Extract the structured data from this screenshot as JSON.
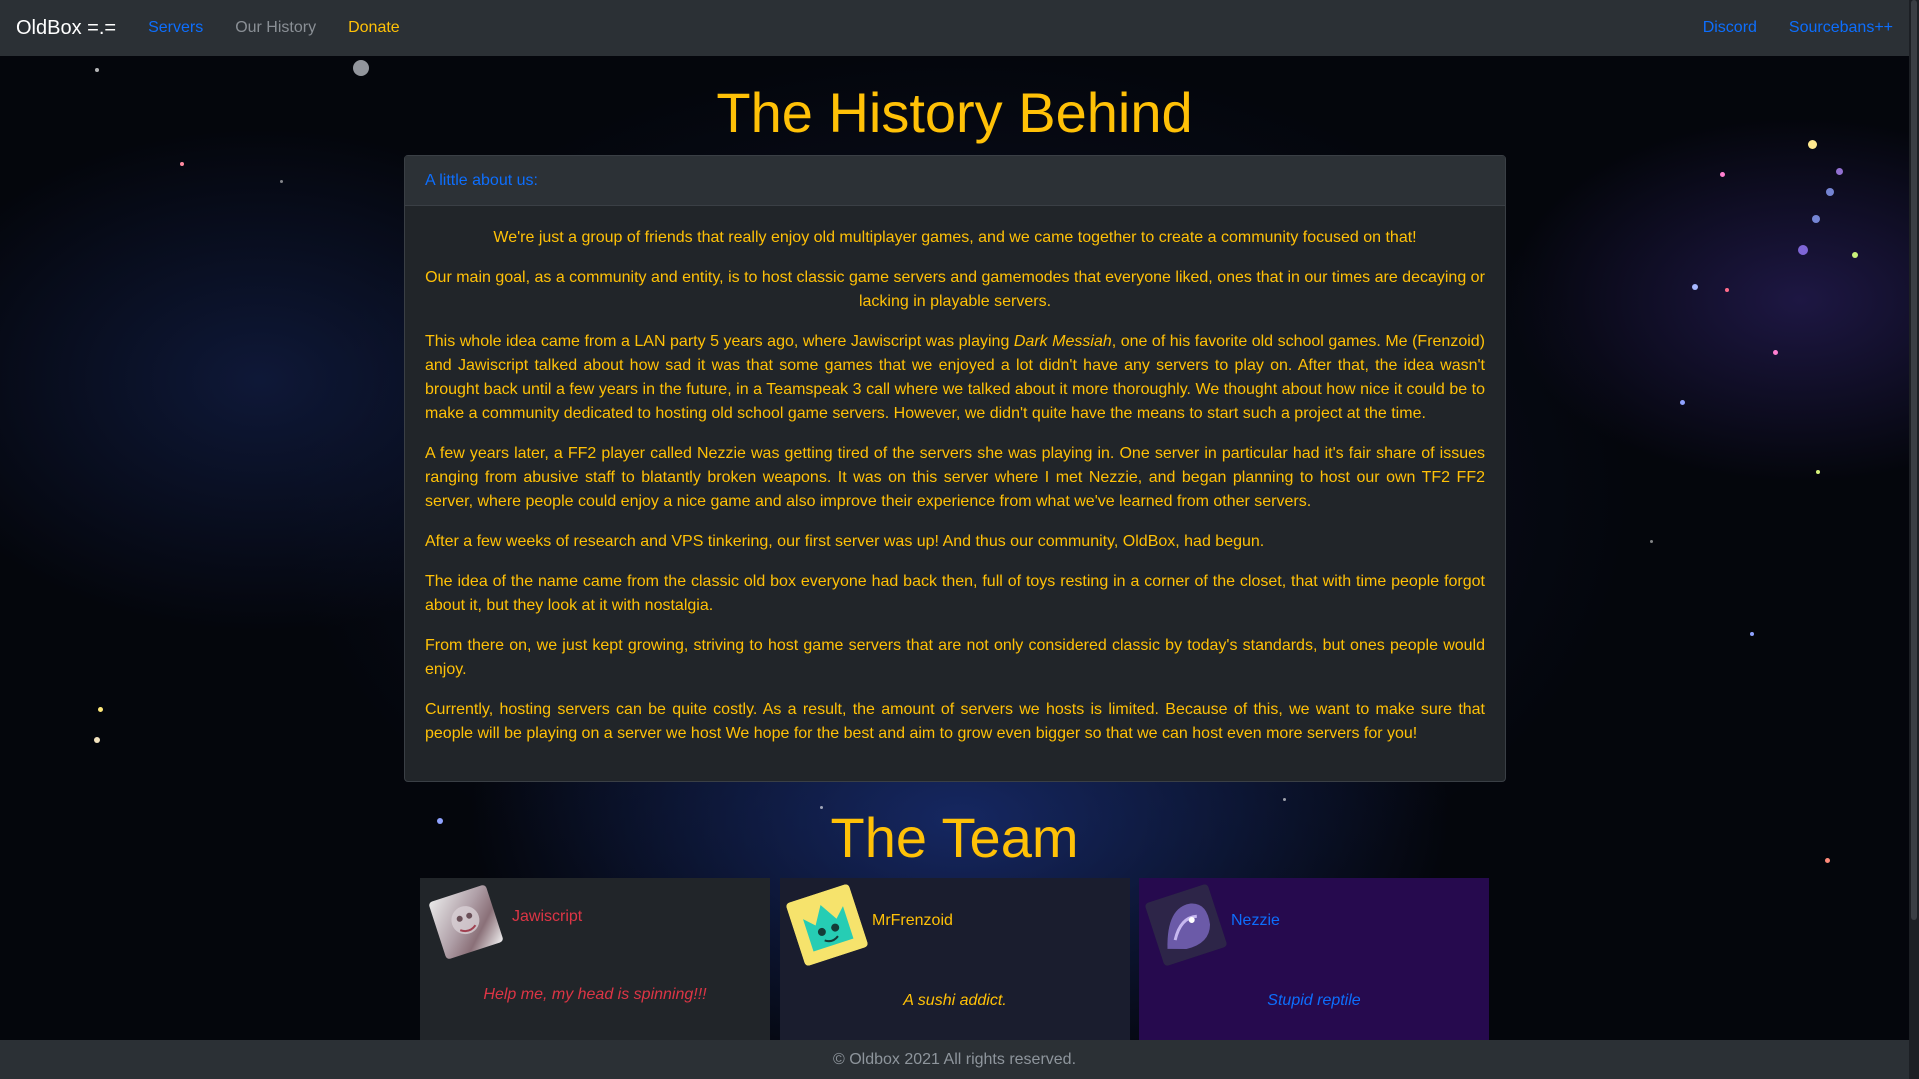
{
  "navbar": {
    "brand": "OldBox =.=",
    "links": [
      {
        "label": "Servers",
        "color": "#0d6efd"
      },
      {
        "label": "Our History",
        "color": "#8a8f95"
      },
      {
        "label": "Donate",
        "color": "#ffc107"
      }
    ],
    "right_links": [
      {
        "label": "Discord",
        "color": "#0d6efd"
      },
      {
        "label": "Sourcebans++",
        "color": "#0d6efd"
      }
    ]
  },
  "history": {
    "title": "The History Behind",
    "card_header": "A little about us:",
    "p1": "We're just a group of friends that really enjoy old multiplayer games, and we came together to create a community focused on that!",
    "p2": "Our main goal, as a community and entity, is to host classic game servers and gamemodes that everyone liked, ones that in our times are decaying or lacking in playable servers.",
    "p3_before": "This whole idea came from a LAN party 5 years ago, where Jawiscript was playing ",
    "p3_em": "Dark Messiah",
    "p3_after": ", one of his favorite old school games. Me (Frenzoid) and Jawiscript talked about how sad it was that some games that we enjoyed a lot didn't have any servers to play on. After that, the idea wasn't brought back until a few years in the future, in a Teamspeak 3 call where we talked about it more thoroughly. We thought about how nice it could be to make a community dedicated to hosting old school game servers. However, we didn't quite have the means to start such a project at the time.",
    "p4": "A few years later, a FF2 player called Nezzie was getting tired of the servers she was playing in. One server in particular had it's fair share of issues ranging from abusive staff to blatantly broken weapons. It was on this server where I met Nezzie, and began planning to host our own TF2 FF2 server, where people could enjoy a nice game and also improve their experience from what we've learned from other servers.",
    "p5": "After a few weeks of research and VPS tinkering, our first server was up! And thus our community, OldBox, had begun.",
    "p6": "The idea of the name came from the classic old box everyone had back then, full of toys resting in a corner of the closet, that with time people forgot about it, but they look at it with nostalgia.",
    "p7": "From there on, we just kept growing, striving to host game servers that are not only considered classic by today's standards, but ones people would enjoy.",
    "p8": "Currently, hosting servers can be quite costly. As a result, the amount of servers we hosts is limited. Because of this, we want to make sure that people will be playing on a server we host We hope for the best and aim to grow even bigger so that we can host even more servers for you!"
  },
  "team": {
    "title": "The Team",
    "members": [
      {
        "name": "Jawiscript",
        "quote": "Help me, my head is spinning!!!",
        "name_color": "#dc3545",
        "quote_color": "#dc3545",
        "bg": "#212529"
      },
      {
        "name": "MrFrenzoid",
        "quote": "A sushi addict.",
        "name_color": "#ffc107",
        "quote_color": "#ffc107",
        "bg": "#1a1d2e"
      },
      {
        "name": "Nezzie",
        "quote": "Stupid reptile",
        "name_color": "#0d6efd",
        "quote_color": "#0d6efd",
        "bg": "#260a4e"
      }
    ]
  },
  "footer": {
    "text": "© Oldbox 2021 All rights reserved."
  }
}
